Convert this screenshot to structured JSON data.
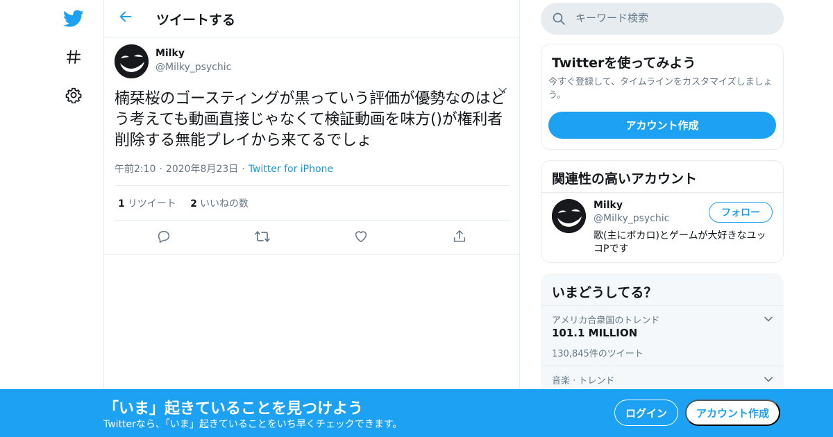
{
  "colors": {
    "accent": "#1da1f2",
    "text": "#14171a",
    "secondary": "#657786",
    "border": "#e6ecf0"
  },
  "nav": {
    "icons": [
      "twitter-logo-icon",
      "hashtag-icon",
      "gear-icon"
    ]
  },
  "header": {
    "title": "ツイートする",
    "back_icon": "arrow-left-icon"
  },
  "tweet": {
    "author_name": "Milky",
    "author_handle": "@Milky_psychic",
    "text": "楠栞桜のゴースティングが黒っていう評価が優勢なのはどう考えても動画直接じゃなくて検証動画を味方()が権利者削除する無能プレイから来てるでしょ",
    "time": "午前2:10",
    "date": "2020年8月23日",
    "source": "Twitter for iPhone",
    "retweet_count": "1",
    "retweet_label": "リツイート",
    "like_count": "2",
    "like_label": "いいねの数",
    "actions": [
      "reply-icon",
      "retweet-icon",
      "like-icon",
      "share-icon"
    ]
  },
  "search": {
    "placeholder": "キーワード検索"
  },
  "signup_card": {
    "title": "Twitterを使ってみよう",
    "description": "今すぐ登録して、タイムラインをカスタマイズしましょう。",
    "button": "アカウント作成"
  },
  "related_card": {
    "title": "関連性の高いアカウント",
    "name": "Milky",
    "handle": "@Milky_psychic",
    "bio": "歌(主にボカロ)とゲームが大好きなユッコPです",
    "follow_button": "フォロー"
  },
  "trends_card": {
    "title": "いまどうしてる？",
    "trends": [
      {
        "context": "アメリカ合衆国のトレンド",
        "name": "101.1 MILLION",
        "count": "130,845件のツイート"
      },
      {
        "context": "音楽 · トレンド",
        "name": "",
        "count": ""
      }
    ]
  },
  "banner": {
    "title": "「いま」起きていることを見つけよう",
    "subtitle": "Twitterなら、「いま」起きていることをいち早くチェックできます。",
    "login_button": "ログイン",
    "signup_button": "アカウント作成"
  }
}
